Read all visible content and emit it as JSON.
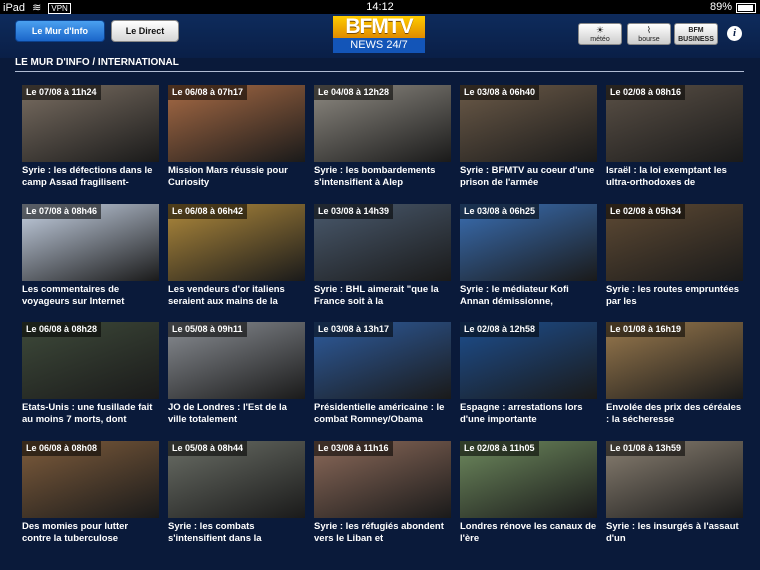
{
  "status": {
    "device": "iPad",
    "vpn": "VPN",
    "time": "14:12",
    "battery": "89%"
  },
  "header": {
    "tab_mur": "Le Mur d'Info",
    "tab_direct": "Le Direct",
    "logo_top": "BFMTV",
    "logo_bottom": "NEWS 24/7",
    "meteo": "météo",
    "bourse": "bourse",
    "bfm_business": "BFM BUSINESS",
    "info": "i"
  },
  "section_title": "LE MUR D'INFO / INTERNATIONAL",
  "cards": [
    {
      "date": "Le 07/08 à 11h24",
      "text": "Syrie : les défections dans le camp Assad fragilisent-",
      "thumb": "#7a6e62"
    },
    {
      "date": "Le 06/08 à 07h17",
      "text": "Mission Mars réussie pour Curiosity",
      "thumb": "#a86b45"
    },
    {
      "date": "Le 04/08 à 12h28",
      "text": "Syrie : les bombardements s'intensifient à Alep",
      "thumb": "#8e8a82"
    },
    {
      "date": "Le 03/08 à 06h40",
      "text": "Syrie : BFMTV au coeur d'une prison de l'armée",
      "thumb": "#6b5a48"
    },
    {
      "date": "Le 02/08 à 08h16",
      "text": "Israël : la loi exemptant les ultra-orthodoxes de",
      "thumb": "#5a5046"
    },
    {
      "date": "Le 07/08 à 08h46",
      "text": "Les commentaires de voyageurs sur Internet",
      "thumb": "#c8d4e6"
    },
    {
      "date": "Le 06/08 à 06h42",
      "text": "Les vendeurs d'or italiens seraient aux mains de la",
      "thumb": "#b08a3c"
    },
    {
      "date": "Le 03/08 à 14h39",
      "text": "Syrie : BHL aimerait \"que la France soit à la",
      "thumb": "#4a5a6e"
    },
    {
      "date": "Le 03/08 à 06h25",
      "text": "Syrie : le médiateur Kofi Annan démissionne,",
      "thumb": "#3a6fb4"
    },
    {
      "date": "Le 02/08 à 05h34",
      "text": "Syrie : les routes empruntées par les",
      "thumb": "#5e4a34"
    },
    {
      "date": "Le 06/08 à 08h28",
      "text": "Etats-Unis : une fusillade fait au moins 7 morts, dont",
      "thumb": "#3e4a3a"
    },
    {
      "date": "Le 05/08 à 09h11",
      "text": "JO de Londres : l'Est de la ville totalement",
      "thumb": "#8a8e94"
    },
    {
      "date": "Le 03/08 à 13h17",
      "text": "Présidentielle américaine : le combat Romney/Obama",
      "thumb": "#2e5c9e"
    },
    {
      "date": "Le 02/08 à 12h58",
      "text": "Espagne : arrestations lors d'une importante",
      "thumb": "#1d4e8e"
    },
    {
      "date": "Le 01/08 à 16h19",
      "text": "Envolée des prix des céréales : la sécheresse",
      "thumb": "#9a7a4e"
    },
    {
      "date": "Le 06/08 à 08h08",
      "text": "Des momies pour lutter contre la tuberculose",
      "thumb": "#7e5c3c"
    },
    {
      "date": "Le 05/08 à 08h44",
      "text": "Syrie : les combats s'intensifient dans la",
      "thumb": "#6a6e66"
    },
    {
      "date": "Le 03/08 à 11h16",
      "text": "Syrie : les réfugiés abondent vers le Liban et",
      "thumb": "#8c6a5a"
    },
    {
      "date": "Le 02/08 à 11h05",
      "text": "Londres rénove les canaux de l'ère",
      "thumb": "#6e8a5e"
    },
    {
      "date": "Le 01/08 à 13h59",
      "text": "Syrie : les insurgés à l'assaut d'un",
      "thumb": "#8a8072"
    }
  ]
}
